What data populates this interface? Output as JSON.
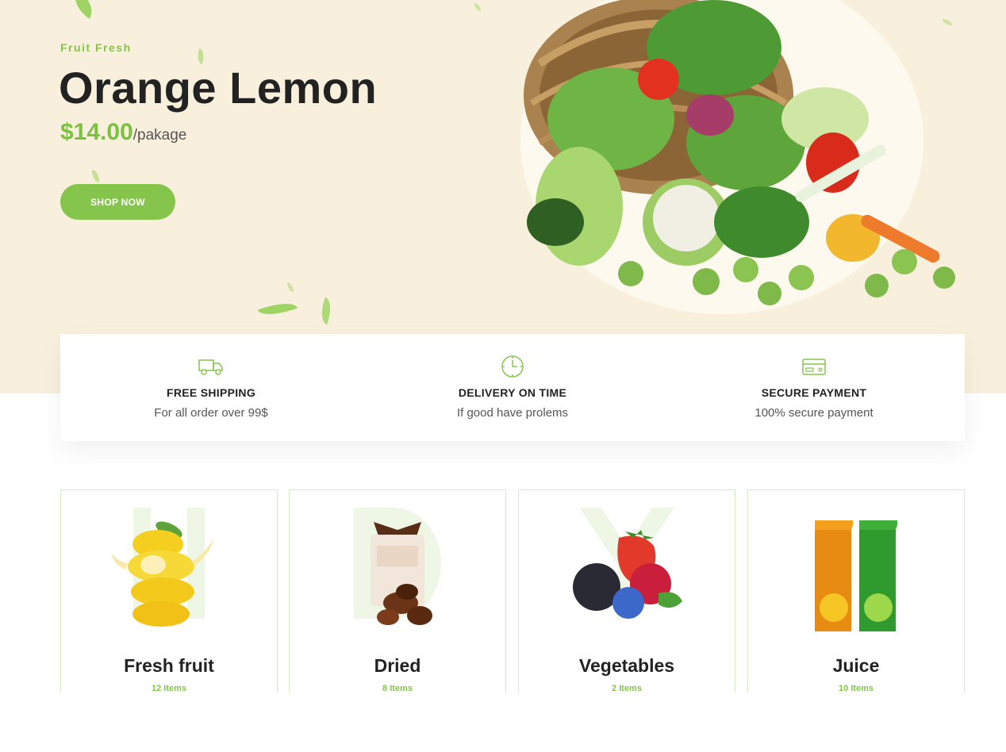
{
  "hero": {
    "eyebrow": "Fruit Fresh",
    "title": "Orange Lemon",
    "price": "$14.00",
    "unit": "/pakage",
    "cta_label": "SHOP NOW",
    "image_icon": "vegetable-basket-image"
  },
  "features": [
    {
      "icon": "truck-icon",
      "title": "FREE SHIPPING",
      "subtitle": "For all order over 99$"
    },
    {
      "icon": "clock-icon",
      "title": "DELIVERY ON TIME",
      "subtitle": "If good have prolems"
    },
    {
      "icon": "credit-card-icon",
      "title": "SECURE PAYMENT",
      "subtitle": "100% secure payment"
    }
  ],
  "categories": [
    {
      "name": "Fresh fruit",
      "count": "12 Items",
      "image": "lemon-splash-image"
    },
    {
      "name": "Dried",
      "count": "8 Items",
      "image": "chocolate-box-image"
    },
    {
      "name": "Vegetables",
      "count": "2 Items",
      "image": "berries-image"
    },
    {
      "name": "Juice",
      "count": "10 Items",
      "image": "juice-cartons-image"
    }
  ],
  "colors": {
    "accent": "#86c54b",
    "hero_bg": "#f8f0dc",
    "card_border": "#d6edc2"
  }
}
